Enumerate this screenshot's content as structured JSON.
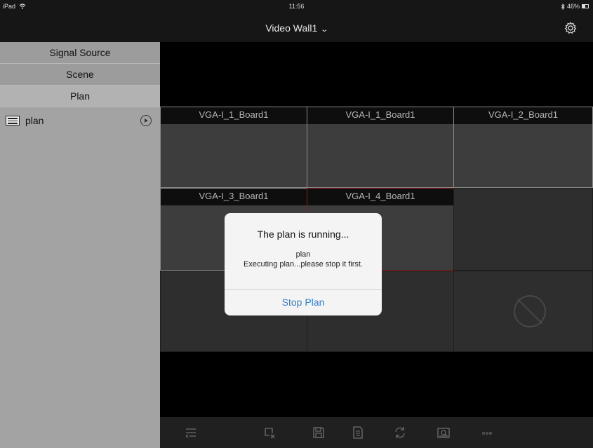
{
  "status_bar": {
    "device": "iPad",
    "time": "11:56",
    "battery_text": "46%",
    "battery_level": 0.46
  },
  "nav": {
    "title": "Video Wall1",
    "icons": {
      "dropdown": "chevron-down-icon",
      "settings": "gear-icon"
    }
  },
  "sidebar": {
    "tabs": [
      {
        "label": "Signal Source",
        "active": false
      },
      {
        "label": "Scene",
        "active": false
      },
      {
        "label": "Plan",
        "active": true
      }
    ],
    "plans": [
      {
        "label": "plan",
        "icon": "list-icon",
        "action_icon": "play-icon"
      }
    ]
  },
  "wall": {
    "cells": [
      {
        "label": "VGA-I_1_Board1"
      },
      {
        "label": "VGA-I_1_Board1"
      },
      {
        "label": "VGA-I_2_Board1"
      },
      {
        "label": "VGA-I_3_Board1"
      },
      {
        "label": "VGA-I_4_Board1",
        "selected": true
      },
      {
        "label": ""
      },
      {
        "label": ""
      },
      {
        "label": ""
      },
      {
        "label": "",
        "icon": "no-entry-icon"
      }
    ]
  },
  "dialog": {
    "title": "The plan is running...",
    "line1": "plan",
    "line2": "Executing plan...please stop it first.",
    "button": "Stop Plan",
    "button_color": "#2f7ed8"
  },
  "toolbar": {
    "icons": [
      "split-icon",
      "clear-window-icon",
      "save-icon",
      "document-icon",
      "refresh-icon",
      "zoom-window-icon",
      "more-icon"
    ]
  }
}
